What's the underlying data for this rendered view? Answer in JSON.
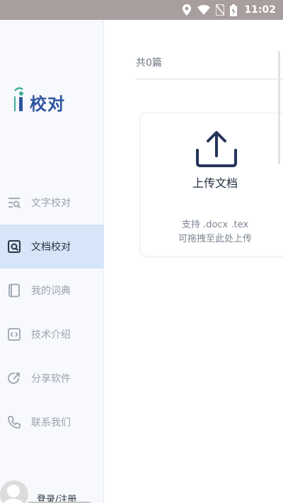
{
  "status_bar": {
    "time": "11:02",
    "icons": [
      "location-icon",
      "wifi-icon",
      "no-sim-icon",
      "battery-charging-icon"
    ]
  },
  "app": {
    "logo_text": "校对"
  },
  "sidebar": {
    "items": [
      {
        "label": "文字校对",
        "icon": "text-proofread-icon",
        "active": false
      },
      {
        "label": "文档校对",
        "icon": "document-proofread-icon",
        "active": true
      },
      {
        "label": "我的词典",
        "icon": "book-icon",
        "active": false
      },
      {
        "label": "技术介绍",
        "icon": "code-icon",
        "active": false
      },
      {
        "label": "分享软件",
        "icon": "share-icon",
        "active": false
      },
      {
        "label": "联系我们",
        "icon": "phone-icon",
        "active": false
      }
    ],
    "login_label": "登录/注册"
  },
  "main": {
    "count_label": "共0篇",
    "upload": {
      "label": "上传文档",
      "support_line1": "支持 .docx .tex",
      "support_line2": "可拖拽至此处上传"
    }
  },
  "colors": {
    "accent": "#2f55a0",
    "active_bg": "#d6e5f8",
    "status_bar": "#a89e9e"
  }
}
